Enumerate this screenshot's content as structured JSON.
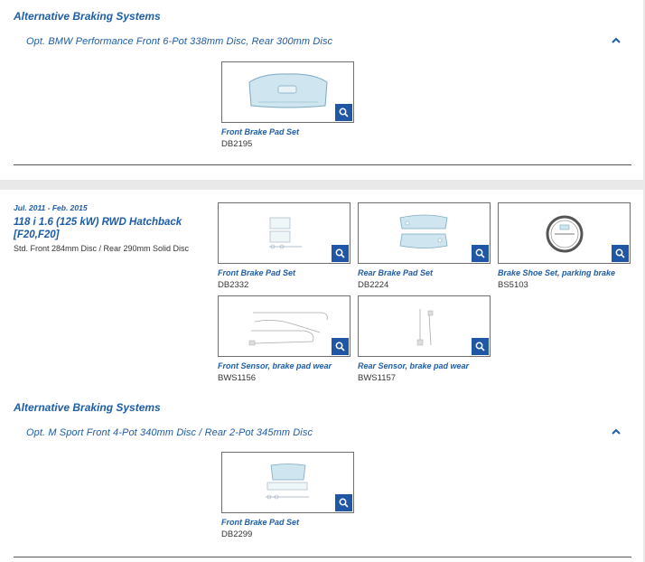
{
  "section1": {
    "title": "Alternative Braking Systems",
    "option": "Opt. BMW Performance Front 6-Pot 338mm Disc, Rear 300mm Disc",
    "products": [
      {
        "caption": "Front Brake Pad Set",
        "code": "DB2195"
      }
    ]
  },
  "vehicle": {
    "date_range": "Jul. 2011 - Feb. 2015",
    "title": "118 i 1.6 (125 kW) RWD Hatchback [F20,F20]",
    "description": "Std. Front 284mm Disc / Rear 290mm Solid Disc",
    "products": [
      {
        "caption": "Front Brake Pad Set",
        "code": "DB2332"
      },
      {
        "caption": "Rear Brake Pad Set",
        "code": "DB2224"
      },
      {
        "caption": "Brake Shoe Set, parking brake",
        "code": "BS5103"
      },
      {
        "caption": "Front Sensor, brake pad wear",
        "code": "BWS1156"
      },
      {
        "caption": "Rear Sensor, brake pad wear",
        "code": "BWS1157"
      }
    ]
  },
  "section2": {
    "title": "Alternative Braking Systems",
    "option": "Opt. M Sport Front 4-Pot 340mm Disc / Rear 2-Pot 345mm Disc",
    "products": [
      {
        "caption": "Front Brake Pad Set",
        "code": "DB2299"
      }
    ]
  },
  "icons": {
    "zoom": "magnifier-icon",
    "collapse": "chevron-up-icon"
  },
  "colors": {
    "accent": "#1d5ca6",
    "zoom_button": "#1f56a5",
    "pad_fill": "#cfe6f0"
  }
}
